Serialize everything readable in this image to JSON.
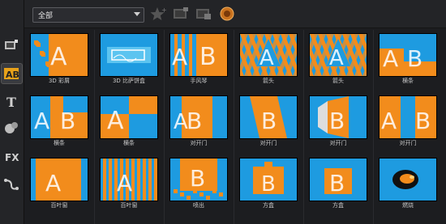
{
  "toolbar": {
    "category_value": "全部",
    "icons": [
      "favorite-add-icon",
      "import-icon",
      "export-icon",
      "online-content-icon"
    ]
  },
  "sidebar": {
    "items": [
      {
        "icon": "media-icon"
      },
      {
        "icon": "transition-icon",
        "active": true
      },
      {
        "icon": "title-icon"
      },
      {
        "icon": "graphics-icon"
      },
      {
        "icon": "fx-icon"
      },
      {
        "icon": "path-icon"
      }
    ]
  },
  "transitions": [
    {
      "label": "3D 彩屑",
      "style": "confetti"
    },
    {
      "label": "3D 比萨饼盒",
      "style": "pizza"
    },
    {
      "label": "手风琴",
      "style": "accordion"
    },
    {
      "label": "箭头",
      "style": "arrow"
    },
    {
      "label": "箭头",
      "style": "arrow"
    },
    {
      "label": "横条",
      "style": "bars"
    },
    {
      "label": "横条",
      "style": "bars2"
    },
    {
      "label": "横条",
      "style": "bars3"
    },
    {
      "label": "对开门",
      "style": "door"
    },
    {
      "label": "对开门",
      "style": "door2"
    },
    {
      "label": "对开门",
      "style": "door3"
    },
    {
      "label": "对开门",
      "style": "door4"
    },
    {
      "label": "百叶窗",
      "style": "blinds"
    },
    {
      "label": "百叶窗",
      "style": "blinds2"
    },
    {
      "label": "喷出",
      "style": "burst"
    },
    {
      "label": "方盒",
      "style": "box"
    },
    {
      "label": "方盒",
      "style": "box2"
    },
    {
      "label": "燃烧",
      "style": "burn"
    }
  ],
  "colors": {
    "blue": "#1e9be0",
    "orange": "#f28c1c",
    "white": "#ffffff"
  }
}
